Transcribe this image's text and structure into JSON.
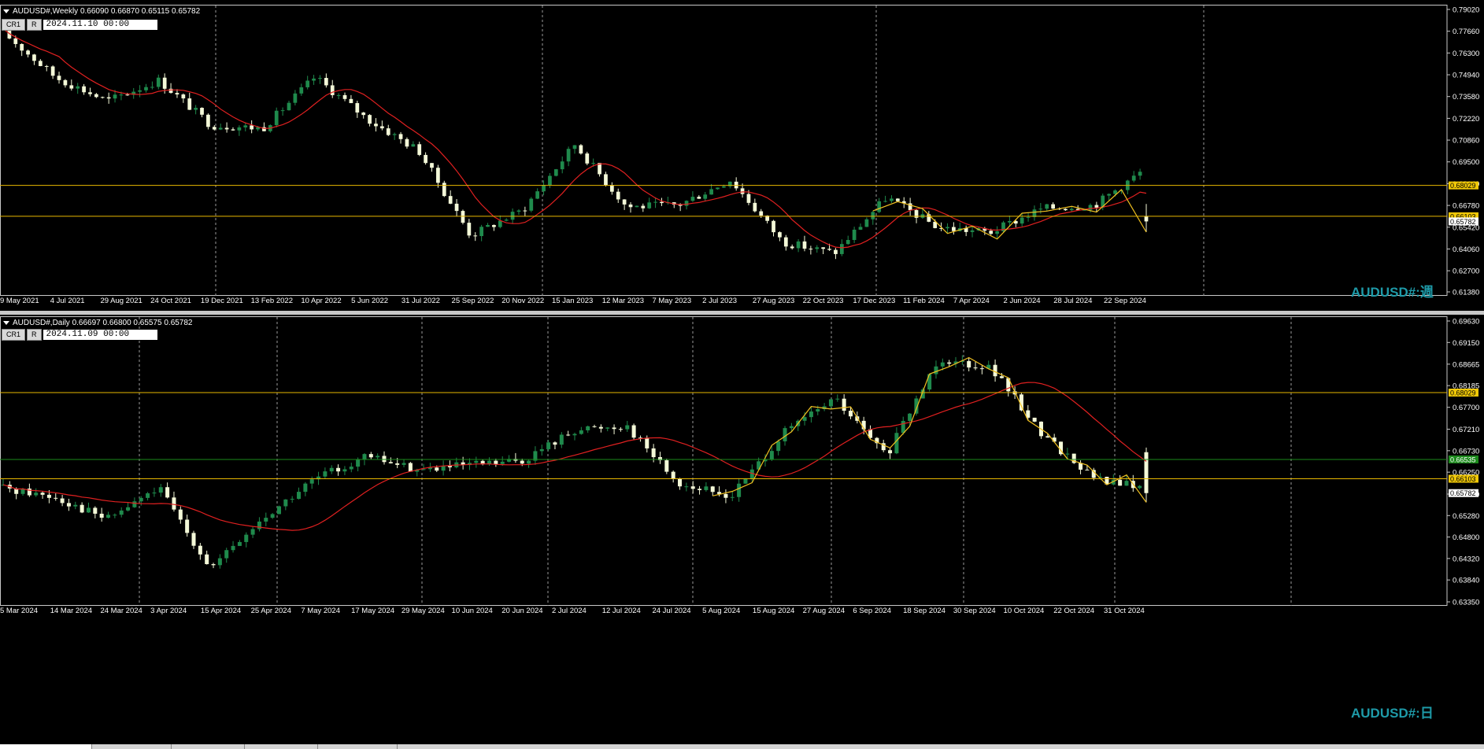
{
  "weekly": {
    "header": "AUDUSD#,Weekly  0.66090 0.66870 0.65115 0.65782",
    "btn1": "CR1",
    "btn2": "R",
    "date_value": "2024.11.10 00:00",
    "watermark": "AUDUSD#:週",
    "price_ticks": [
      "0.79020",
      "0.77660",
      "0.76300",
      "0.74940",
      "0.73580",
      "0.72220",
      "0.70860",
      "0.69500",
      "0.68140",
      "0.66780",
      "0.65420",
      "0.64060",
      "0.62700",
      "0.61380"
    ],
    "tick_top_value": 0.7902,
    "tick_bottom_value": 0.6138,
    "hlines": [
      0.68029,
      0.66103
    ],
    "price_labels": [
      {
        "text": "0.68029",
        "value": 0.68029,
        "bg": "#f0c808",
        "fg": "#000000"
      },
      {
        "text": "0.66103",
        "value": 0.66103,
        "bg": "#f0c808",
        "fg": "#000000"
      },
      {
        "text": "0.65782",
        "value": 0.65782,
        "bg": "#ffffff",
        "fg": "#000000"
      }
    ],
    "date_labels": [
      "9 May 2021",
      "4 Jul 2021",
      "29 Aug 2021",
      "24 Oct 2021",
      "19 Dec 2021",
      "13 Feb 2022",
      "10 Apr 2022",
      "5 Jun 2022",
      "31 Jul 2022",
      "25 Sep 2022",
      "20 Nov 2022",
      "15 Jan 2023",
      "12 Mar 2023",
      "7 May 2023",
      "2 Jul 2023",
      "27 Aug 2023",
      "22 Oct 2023",
      "17 Dec 2023",
      "11 Feb 2024",
      "7 Apr 2024",
      "2 Jun 2024",
      "28 Jul 2024",
      "22 Sep 2024"
    ]
  },
  "daily": {
    "header": "AUDUSD#,Daily  0.66697 0.66800 0.65575 0.65782",
    "btn1": "CR1",
    "btn2": "R",
    "date_value": "2024.11.09 00:00",
    "watermark": "AUDUSD#:日",
    "price_ticks": [
      "0.69630",
      "0.69150",
      "0.68665",
      "0.68185",
      "0.67700",
      "0.67210",
      "0.66730",
      "0.66250",
      "0.65760",
      "0.65280",
      "0.64800",
      "0.64320",
      "0.63840",
      "0.63350"
    ],
    "tick_top_value": 0.6963,
    "tick_bottom_value": 0.6335,
    "hlines": [
      0.68029,
      0.66103
    ],
    "green_line": 0.66535,
    "price_labels": [
      {
        "text": "0.68029",
        "value": 0.68029,
        "bg": "#f0c808",
        "fg": "#000000"
      },
      {
        "text": "0.66535",
        "value": 0.66535,
        "bg": "#1c8a1c",
        "fg": "#ffffff"
      },
      {
        "text": "0.66103",
        "value": 0.66103,
        "bg": "#f0c808",
        "fg": "#000000"
      },
      {
        "text": "0.65782",
        "value": 0.65782,
        "bg": "#ffffff",
        "fg": "#000000"
      }
    ],
    "date_labels": [
      "5 Mar 2024",
      "14 Mar 2024",
      "24 Mar 2024",
      "3 Apr 2024",
      "15 Apr 2024",
      "25 Apr 2024",
      "7 May 2024",
      "17 May 2024",
      "29 May 2024",
      "10 Jun 2024",
      "20 Jun 2024",
      "2 Jul 2024",
      "12 Jul 2024",
      "24 Jul 2024",
      "5 Aug 2024",
      "15 Aug 2024",
      "27 Aug 2024",
      "6 Sep 2024",
      "18 Sep 2024",
      "30 Sep 2024",
      "10 Oct 2024",
      "22 Oct 2024",
      "31 Oct 2024"
    ]
  },
  "colors": {
    "background": "#000000",
    "bull_candle": "#1f8a4c",
    "bear_candle": "#f4f9d8",
    "ma_line": "#e02020",
    "zigzag": "#f0c020",
    "hline": "#e8b800",
    "green_line": "#1c8a1c",
    "grid": "#9a9a9a"
  },
  "chart_data": [
    {
      "type": "candlestick",
      "title": "AUDUSD#,Weekly",
      "ylim": [
        0.6138,
        0.7902
      ],
      "x": [
        "9 May 2021",
        "4 Jul 2021",
        "29 Aug 2021",
        "24 Oct 2021",
        "19 Dec 2021",
        "13 Feb 2022",
        "10 Apr 2022",
        "5 Jun 2022",
        "31 Jul 2022",
        "25 Sep 2022",
        "20 Nov 2022",
        "15 Jan 2023",
        "12 Mar 2023",
        "7 May 2023",
        "2 Jul 2023",
        "27 Aug 2023",
        "22 Oct 2023",
        "17 Dec 2023",
        "11 Feb 2024",
        "7 Apr 2024",
        "2 Jun 2024",
        "28 Jul 2024",
        "22 Sep 2024"
      ],
      "close": [
        0.776,
        0.748,
        0.733,
        0.746,
        0.718,
        0.716,
        0.748,
        0.722,
        0.702,
        0.649,
        0.665,
        0.706,
        0.667,
        0.668,
        0.684,
        0.645,
        0.638,
        0.673,
        0.654,
        0.651,
        0.666,
        0.668,
        0.691
      ],
      "last": {
        "open": 0.6609,
        "high": 0.6687,
        "low": 0.65115,
        "close": 0.65782
      },
      "horizontal_levels": [
        0.68029,
        0.66103
      ]
    },
    {
      "type": "candlestick",
      "title": "AUDUSD#,Daily",
      "ylim": [
        0.6335,
        0.6963
      ],
      "x": [
        "5 Mar 2024",
        "14 Mar 2024",
        "24 Mar 2024",
        "3 Apr 2024",
        "15 Apr 2024",
        "25 Apr 2024",
        "7 May 2024",
        "17 May 2024",
        "29 May 2024",
        "10 Jun 2024",
        "20 Jun 2024",
        "2 Jul 2024",
        "12 Jul 2024",
        "24 Jul 2024",
        "5 Aug 2024",
        "15 Aug 2024",
        "27 Aug 2024",
        "6 Sep 2024",
        "18 Sep 2024",
        "30 Sep 2024",
        "10 Oct 2024",
        "22 Oct 2024",
        "31 Oct 2024"
      ],
      "close": [
        0.659,
        0.657,
        0.652,
        0.659,
        0.641,
        0.652,
        0.661,
        0.666,
        0.663,
        0.664,
        0.665,
        0.672,
        0.673,
        0.66,
        0.657,
        0.671,
        0.679,
        0.666,
        0.688,
        0.686,
        0.671,
        0.661,
        0.659
      ],
      "last": {
        "open": 0.66697,
        "high": 0.668,
        "low": 0.65575,
        "close": 0.65782
      },
      "horizontal_levels": [
        0.68029,
        0.66535,
        0.66103
      ]
    }
  ]
}
